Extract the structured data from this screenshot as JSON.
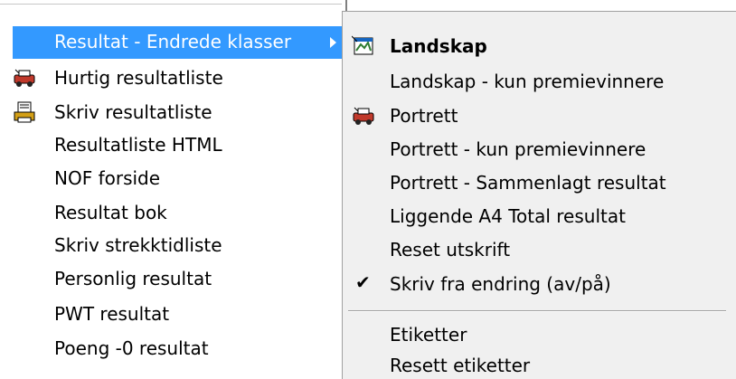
{
  "left_menu": {
    "items": [
      {
        "label": "Resultat - Endrede klasser",
        "icon": "none",
        "selected": true,
        "has_submenu": true
      },
      {
        "label": "Hurtig resultatliste",
        "icon": "car-print-icon"
      },
      {
        "label": "Skriv resultatliste",
        "icon": "document-print-icon"
      },
      {
        "label": "Resultatliste HTML",
        "icon": "none"
      },
      {
        "label": "NOF forside",
        "icon": "none"
      },
      {
        "label": "Resultat bok",
        "icon": "none"
      },
      {
        "label": "Skriv strekktidliste",
        "icon": "none"
      },
      {
        "label": "Personlig resultat",
        "icon": "none"
      },
      {
        "label": "PWT resultat",
        "icon": "none"
      },
      {
        "label": "Poeng -0 resultat",
        "icon": "none"
      }
    ]
  },
  "sub_menu": {
    "items": [
      {
        "label": "Landskap",
        "icon": "landscape-print-icon",
        "bold": true
      },
      {
        "label": "Landskap - kun premievinnere"
      },
      {
        "label": "Portrett",
        "icon": "car-print-icon"
      },
      {
        "label": "Portrett - kun premievinnere"
      },
      {
        "label": "Portrett - Sammenlagt resultat"
      },
      {
        "label": "Liggende A4 Total resultat"
      },
      {
        "label": "Reset utskrift"
      },
      {
        "label": "Skriv fra endring (av/på)",
        "checked": true
      },
      {
        "label": "Etiketter"
      },
      {
        "label": "Resett etiketter"
      }
    ]
  },
  "colors": {
    "selection": "#3399ff",
    "submenu_bg": "#f0f0f0",
    "menu_bg": "#ffffff"
  }
}
